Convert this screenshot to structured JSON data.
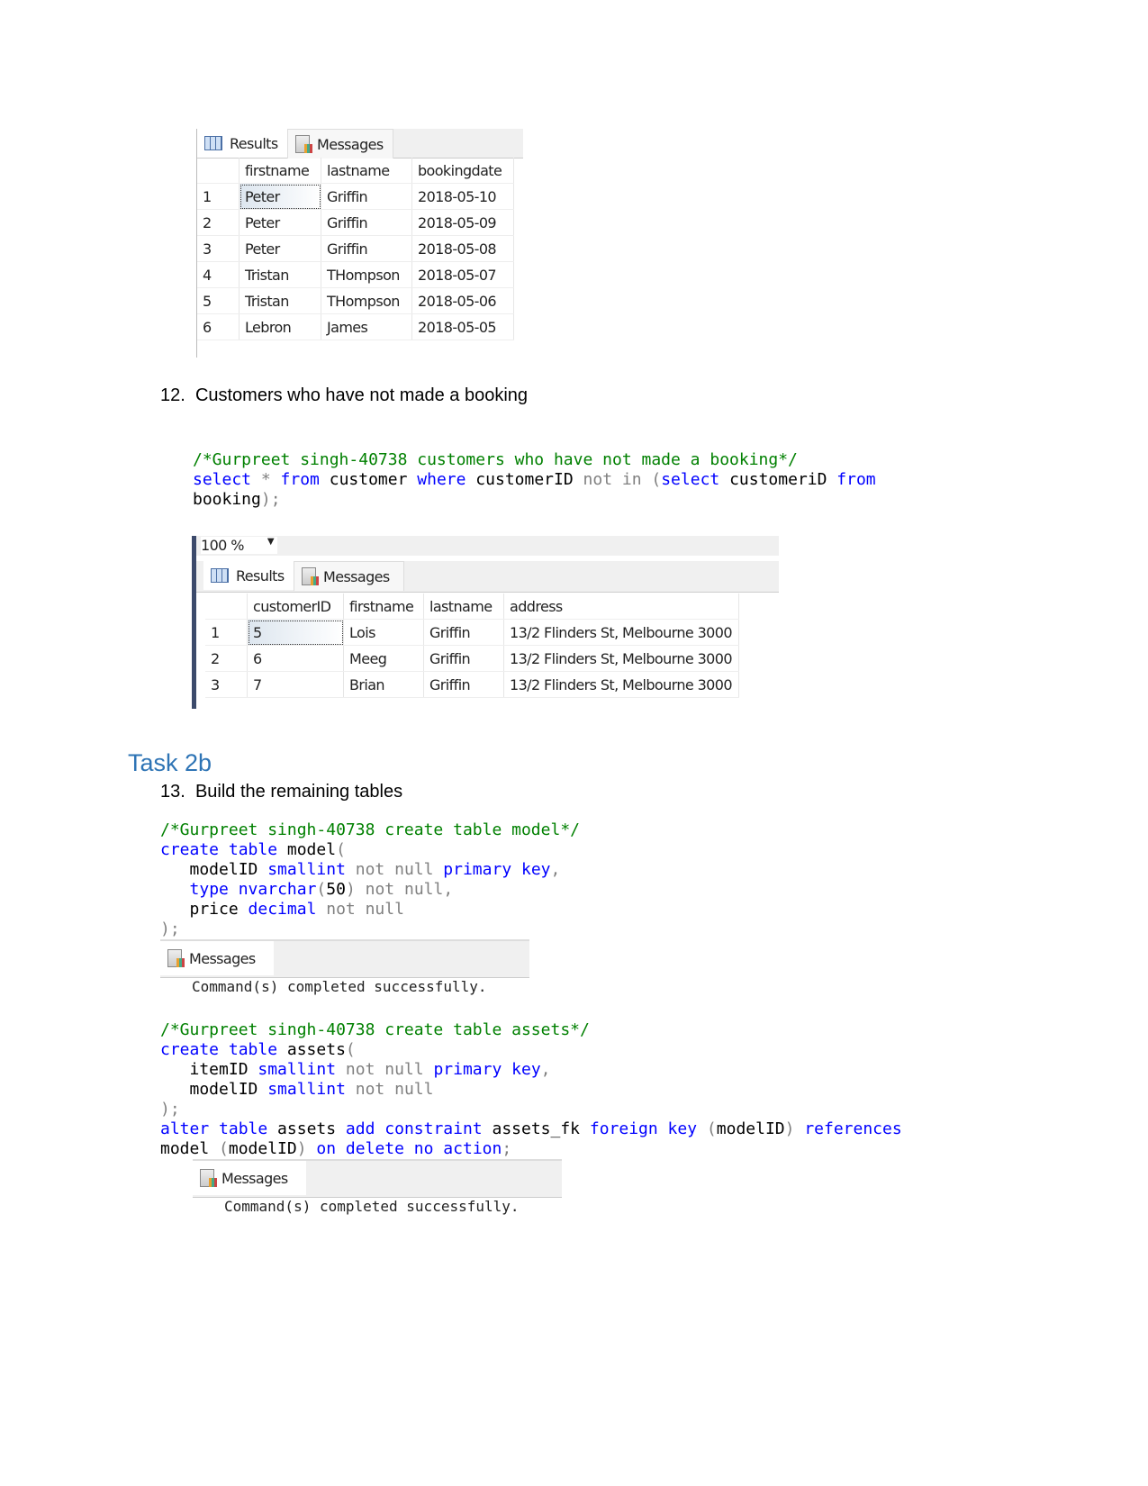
{
  "result1": {
    "tabs": {
      "results": "Results",
      "messages": "Messages"
    },
    "columns": [
      "",
      "firstname",
      "lastname",
      "bookingdate"
    ],
    "rows": [
      [
        "1",
        "Peter",
        "Griffin",
        "2018-05-10"
      ],
      [
        "2",
        "Peter",
        "Griffin",
        "2018-05-09"
      ],
      [
        "3",
        "Peter",
        "Griffin",
        "2018-05-08"
      ],
      [
        "4",
        "Tristan",
        "THompson",
        "2018-05-07"
      ],
      [
        "5",
        "Tristan",
        "THompson",
        "2018-05-06"
      ],
      [
        "6",
        "Lebron",
        "James",
        "2018-05-05"
      ]
    ]
  },
  "item12": {
    "number": "12.",
    "text": "Customers who have not made a booking"
  },
  "code12": [
    [
      [
        "/*Gurpreet singh-40738 customers who have not made a booking*/",
        "cm"
      ]
    ],
    [
      [
        "select",
        "kw"
      ],
      [
        " * ",
        "op"
      ],
      [
        "from",
        "kw"
      ],
      [
        " customer ",
        "id"
      ],
      [
        "where",
        "kw"
      ],
      [
        " customerID ",
        "id"
      ],
      [
        "not in (",
        "op"
      ],
      [
        "select",
        "kw"
      ],
      [
        " customeriD ",
        "id"
      ],
      [
        "from",
        "kw"
      ]
    ],
    [
      [
        "booking",
        "id"
      ],
      [
        ");",
        "op"
      ]
    ]
  ],
  "result2": {
    "zoom": "100 %",
    "tabs": {
      "results": "Results",
      "messages": "Messages"
    },
    "columns": [
      "",
      "customerID",
      "firstname",
      "lastname",
      "address"
    ],
    "rows": [
      [
        "1",
        "5",
        "Lois",
        "Griffin",
        "13/2 Flinders St, Melbourne 3000"
      ],
      [
        "2",
        "6",
        "Meeg",
        "Griffin",
        "13/2 Flinders St, Melbourne 3000"
      ],
      [
        "3",
        "7",
        "Brian",
        "Griffin",
        "13/2 Flinders St, Melbourne 3000"
      ]
    ]
  },
  "task_heading": "Task 2b",
  "item13": {
    "number": "13.",
    "text": "Build the remaining tables"
  },
  "code13a": [
    [
      [
        "/*Gurpreet singh-40738 create table model*/",
        "cm"
      ]
    ],
    [
      [
        "create table",
        "kw"
      ],
      [
        " model",
        "id"
      ],
      [
        "(",
        "op"
      ]
    ],
    [
      [
        "   modelID ",
        "id"
      ],
      [
        "smallint",
        "kw"
      ],
      [
        " not null ",
        "op"
      ],
      [
        "primary key",
        "kw"
      ],
      [
        ",",
        "op"
      ]
    ],
    [
      [
        "   ",
        "id"
      ],
      [
        "type",
        "kw"
      ],
      [
        " ",
        "id"
      ],
      [
        "nvarchar",
        "kw"
      ],
      [
        "(",
        "op"
      ],
      [
        "50",
        "id"
      ],
      [
        ")",
        "op"
      ],
      [
        " not null,",
        "op"
      ]
    ],
    [
      [
        "   price ",
        "id"
      ],
      [
        "decimal",
        "kw"
      ],
      [
        " not null",
        "op"
      ]
    ],
    [
      [
        ");",
        "op"
      ]
    ]
  ],
  "messages1": {
    "tab": "Messages",
    "output": "Command(s) completed successfully."
  },
  "code13b": [
    [
      [
        "/*Gurpreet singh-40738 create table assets*/",
        "cm"
      ]
    ],
    [
      [
        "create table",
        "kw"
      ],
      [
        " assets",
        "id"
      ],
      [
        "(",
        "op"
      ]
    ],
    [
      [
        "   itemID ",
        "id"
      ],
      [
        "smallint",
        "kw"
      ],
      [
        " not null ",
        "op"
      ],
      [
        "primary key",
        "kw"
      ],
      [
        ",",
        "op"
      ]
    ],
    [
      [
        "   modelID ",
        "id"
      ],
      [
        "smallint",
        "kw"
      ],
      [
        " not null",
        "op"
      ]
    ],
    [
      [
        ");",
        "op"
      ]
    ],
    [
      [
        "alter table",
        "kw"
      ],
      [
        " assets ",
        "id"
      ],
      [
        "add constraint",
        "kw"
      ],
      [
        " assets_fk ",
        "id"
      ],
      [
        "foreign key",
        "kw"
      ],
      [
        " (",
        "op"
      ],
      [
        "modelID",
        "id"
      ],
      [
        ")",
        "op"
      ],
      [
        " ",
        "id"
      ],
      [
        "references",
        "kw"
      ]
    ],
    [
      [
        "model ",
        "id"
      ],
      [
        "(",
        "op"
      ],
      [
        "modelID",
        "id"
      ],
      [
        ")",
        "op"
      ],
      [
        " ",
        "id"
      ],
      [
        "on delete no action",
        "kw"
      ],
      [
        ";",
        "op"
      ]
    ]
  ],
  "messages2": {
    "tab": "Messages",
    "output": "Command(s) completed successfully."
  }
}
